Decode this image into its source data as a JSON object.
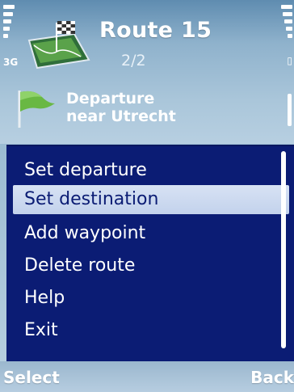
{
  "status": {
    "network_label": "3G"
  },
  "header": {
    "title": "Route 15",
    "route_count": "2/2",
    "departure_line1": "Departure",
    "departure_line2": "near Utrecht",
    "app_icon": "navigation-app-icon",
    "flag_icon": "green-flag-icon"
  },
  "menu": {
    "items": [
      {
        "label": "Set departure"
      },
      {
        "label": "Set destination",
        "selected": true
      },
      {
        "label": "Add waypoint"
      },
      {
        "label": "Delete route"
      },
      {
        "label": "Help"
      },
      {
        "label": "Exit"
      }
    ]
  },
  "softkeys": {
    "left": "Select",
    "right": "Back"
  },
  "colors": {
    "menu_bg": "#0b1c74",
    "highlight_bg": "#c9d7ee",
    "header_bg": "#8fb2cc"
  }
}
